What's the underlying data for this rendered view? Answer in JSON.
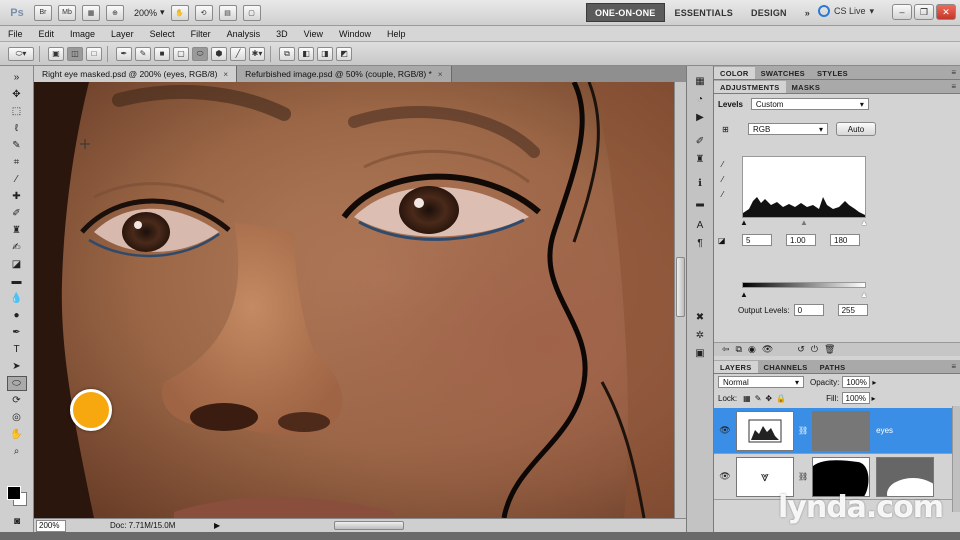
{
  "appbar": {
    "logo": "Ps",
    "zoom": "200%",
    "btn_br": "Br",
    "btn_mb": "Mb",
    "workspaces": [
      "ONE-ON-ONE",
      "ESSENTIALS",
      "DESIGN"
    ],
    "more": "»",
    "cslive": "CS Live",
    "active_workspace_color": "#5b5b5b"
  },
  "menu": [
    "File",
    "Edit",
    "Image",
    "Layer",
    "Select",
    "Filter",
    "Analysis",
    "3D",
    "View",
    "Window",
    "Help"
  ],
  "tabs": [
    {
      "label": "Right eye masked.psd @ 200% (eyes, RGB/8)",
      "close": "×"
    },
    {
      "label": "Refurbished image.psd @ 50% (couple, RGB/8) *",
      "close": "×"
    }
  ],
  "status": {
    "zoom": "200%",
    "doc": "Doc: 7.71M/15.0M"
  },
  "panels": {
    "top_tabs": [
      "COLOR",
      "SWATCHES",
      "STYLES"
    ],
    "adj_tabs": [
      "ADJUSTMENTS",
      "MASKS"
    ],
    "layer_tabs": [
      "LAYERS",
      "CHANNELS",
      "PATHS"
    ]
  },
  "adjustments": {
    "title": "Levels",
    "preset": "Custom",
    "channel": "RGB",
    "auto": "Auto",
    "input_black": "5",
    "input_gamma": "1.00",
    "input_white": "180",
    "output_label": "Output Levels:",
    "output_black": "0",
    "output_white": "255"
  },
  "layers": {
    "blend_mode": "Normal",
    "opacity_label": "Opacity:",
    "opacity": "100%",
    "lock_label": "Lock:",
    "fill_label": "Fill:",
    "fill": "100%",
    "items": [
      {
        "name": "eyes",
        "selected": true
      },
      {
        "name": "",
        "selected": false
      }
    ],
    "selection_color": "#3a8ee6"
  },
  "watermark": "lynda.com",
  "icons": {
    "eye": "eye-icon",
    "move": "move-tool-icon",
    "brush": "brush-tool-icon"
  }
}
